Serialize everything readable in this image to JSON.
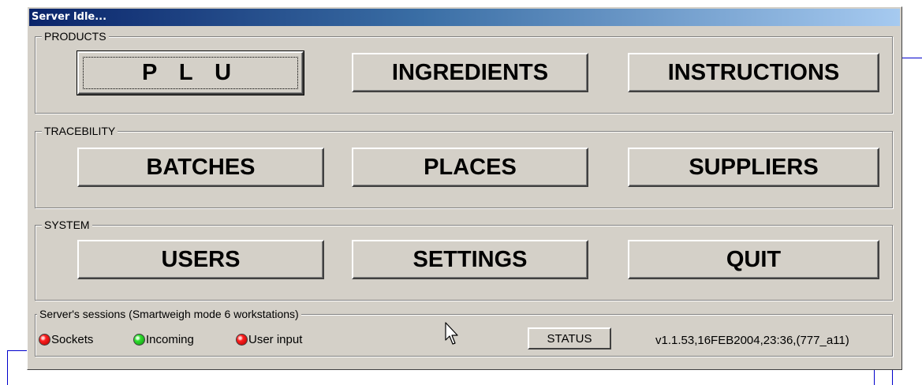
{
  "window": {
    "title": "Server Idle..."
  },
  "products": {
    "label": "PRODUCTS",
    "buttons": [
      "P L U",
      "INGREDIENTS",
      "INSTRUCTIONS"
    ]
  },
  "tracebility": {
    "label": "TRACEBILITY",
    "buttons": [
      "BATCHES",
      "PLACES",
      "SUPPLIERS"
    ]
  },
  "system": {
    "label": "SYSTEM",
    "buttons": [
      "USERS",
      "SETTINGS",
      "QUIT"
    ]
  },
  "sessions": {
    "label": "Server's sessions (Smartweigh mode 6 workstations)",
    "indicators": [
      {
        "label": "Sockets",
        "color": "#ff0000"
      },
      {
        "label": "Incoming",
        "color": "#00cc00"
      },
      {
        "label": "User input",
        "color": "#ff0000"
      }
    ],
    "status_button": "STATUS",
    "version": "v1.1.53,16FEB2004,23:36,(777_a11)"
  },
  "icons": {
    "cursor": "mouse-pointer-icon"
  }
}
